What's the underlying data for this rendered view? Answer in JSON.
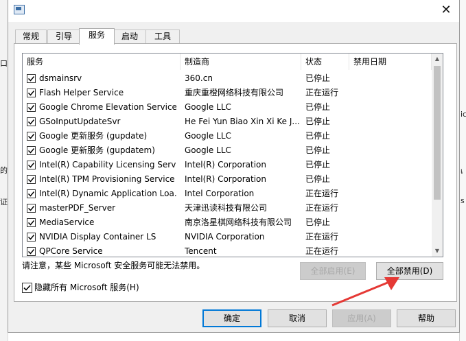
{
  "tabs": [
    {
      "label": "常规",
      "active": false
    },
    {
      "label": "引导",
      "active": false
    },
    {
      "label": "服务",
      "active": true
    },
    {
      "label": "启动",
      "active": false
    },
    {
      "label": "工具",
      "active": false
    }
  ],
  "columns": {
    "service": "服务",
    "manufacturer": "制造商",
    "status": "状态",
    "disabled_date": "禁用日期"
  },
  "services": [
    {
      "checked": true,
      "name": "dsmainsrv",
      "manufacturer": "360.cn",
      "status": "已停止",
      "date": ""
    },
    {
      "checked": true,
      "name": "Flash Helper Service",
      "manufacturer": "重庆重橙网络科技有限公司",
      "status": "正在运行",
      "date": ""
    },
    {
      "checked": true,
      "name": "Google Chrome Elevation Service",
      "manufacturer": "Google LLC",
      "status": "已停止",
      "date": ""
    },
    {
      "checked": true,
      "name": "GSoInputUpdateSvr",
      "manufacturer": "He Fei Yun Biao Xin Xi Ke J...",
      "status": "已停止",
      "date": ""
    },
    {
      "checked": true,
      "name": "Google 更新服务 (gupdate)",
      "manufacturer": "Google LLC",
      "status": "已停止",
      "date": ""
    },
    {
      "checked": true,
      "name": "Google 更新服务 (gupdatem)",
      "manufacturer": "Google LLC",
      "status": "已停止",
      "date": ""
    },
    {
      "checked": true,
      "name": "Intel(R) Capability Licensing Servi...",
      "manufacturer": "Intel(R) Corporation",
      "status": "已停止",
      "date": ""
    },
    {
      "checked": true,
      "name": "Intel(R) TPM Provisioning Service",
      "manufacturer": "Intel(R) Corporation",
      "status": "已停止",
      "date": ""
    },
    {
      "checked": true,
      "name": "Intel(R) Dynamic Application Loa...",
      "manufacturer": "Intel Corporation",
      "status": "正在运行",
      "date": ""
    },
    {
      "checked": true,
      "name": "masterPDF_Server",
      "manufacturer": "天津迅读科技有限公司",
      "status": "正在运行",
      "date": ""
    },
    {
      "checked": true,
      "name": "MediaService",
      "manufacturer": "南京洛星棋网络科技有限公司",
      "status": "已停止",
      "date": ""
    },
    {
      "checked": true,
      "name": "NVIDIA Display Container LS",
      "manufacturer": "NVIDIA Corporation",
      "status": "正在运行",
      "date": ""
    },
    {
      "checked": true,
      "name": "QPCore Service",
      "manufacturer": "Tencent",
      "status": "正在运行",
      "date": ""
    }
  ],
  "note": "请注意，某些 Microsoft 安全服务可能无法禁用。",
  "buttons": {
    "enable_all": "全部启用(E)",
    "disable_all": "全部禁用(D)",
    "ok": "确定",
    "cancel": "取消",
    "apply": "应用(A)",
    "help": "帮助"
  },
  "hide_ms": {
    "label": "隐藏所有 Microsoft 服务(H)",
    "checked": true
  },
  "background": {
    "left": [
      "口",
      "的",
      "证",
      "♀",
      "ๆ"
    ],
    "right": [
      "ics",
      "เ",
      "s"
    ]
  },
  "colors": {
    "accent": "#0078d7",
    "annotation_arrow": "#e53935"
  }
}
